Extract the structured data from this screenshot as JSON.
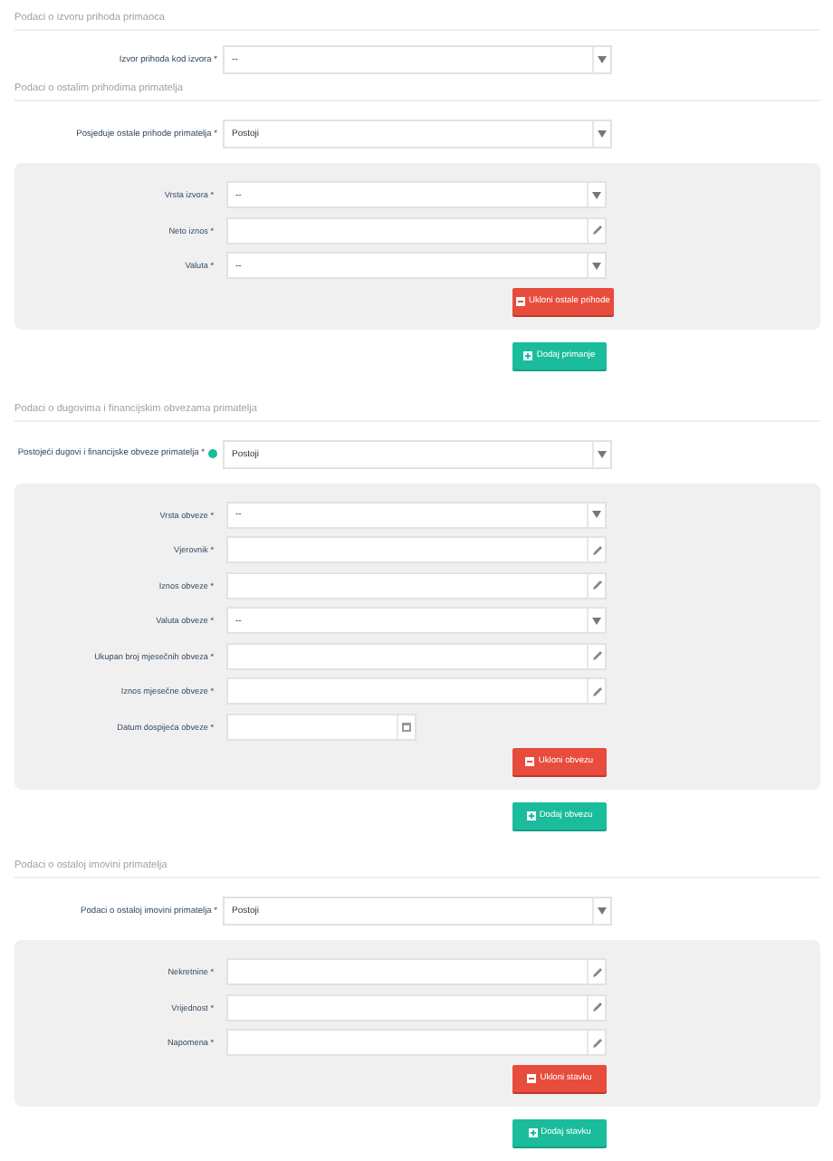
{
  "sections": [
    {
      "title": "Podaci o izvoru prihoda primaoca",
      "main_field": {
        "label": "Izvor prihoda kod izvora *",
        "kind": "select",
        "value": "--"
      }
    },
    {
      "title": "Podaci o ostalim prihodima primatelja",
      "main_field": {
        "label": "Posjeduje ostale prihode primatelja *",
        "kind": "select",
        "value": "Postoji"
      },
      "panel": {
        "fields": [
          {
            "label": "Vrsta izvora *",
            "kind": "select",
            "value": "--"
          },
          {
            "label": "Neto iznos *",
            "kind": "text"
          },
          {
            "label": "Valuta *",
            "kind": "select",
            "value": "--"
          }
        ],
        "remove_button": "Ukloni ostale prihode"
      },
      "add_button": "Dodaj primanje"
    },
    {
      "title": "Podaci o dugovima i financijskim obvezama primatelja",
      "main_field": {
        "label": "Postojeći dugovi i financijske obveze primatelja *",
        "kind": "select",
        "value": "Postoji",
        "info": true
      },
      "panel": {
        "fields": [
          {
            "label": "Vrsta obveze *",
            "kind": "select",
            "value": "--"
          },
          {
            "label": "Vjerovnik *",
            "kind": "text"
          },
          {
            "label": "Iznos obveze *",
            "kind": "text"
          },
          {
            "label": "Valuta obveze *",
            "kind": "select",
            "value": "--"
          },
          {
            "label": "Ukupan broj mjesečnih obveza *",
            "kind": "text"
          },
          {
            "label": "Iznos mjesečne obveze *",
            "kind": "text"
          },
          {
            "label": "Datum dospijeća obveze *",
            "kind": "date"
          }
        ],
        "remove_button": "Ukloni obvezu"
      },
      "add_button": "Dodaj obvezu"
    },
    {
      "title": "Podaci o ostaloj imovini primatelja",
      "main_field": {
        "label": "Podaci o ostaloj imovini primatelja *",
        "kind": "select",
        "value": "Postoji"
      },
      "panel": {
        "fields": [
          {
            "label": "Nekretnine *",
            "kind": "text"
          },
          {
            "label": "Vrijednost *",
            "kind": "text"
          },
          {
            "label": "Napomena *",
            "kind": "text"
          }
        ],
        "remove_button": "Ukloni stavku"
      },
      "add_button": "Dodaj stavku"
    }
  ]
}
